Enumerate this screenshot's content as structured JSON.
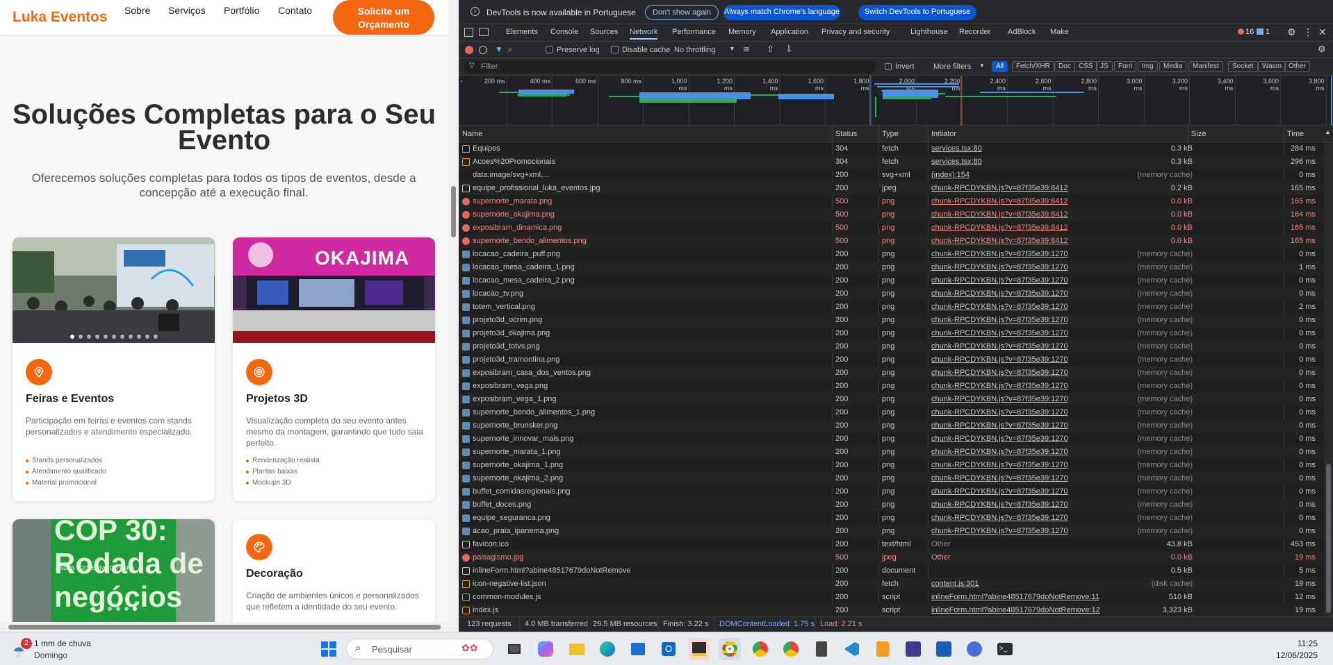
{
  "website": {
    "brand": "Luka Eventos",
    "nav": [
      "Sobre",
      "Serviços",
      "Portfólio",
      "Contato"
    ],
    "cta": "Solicite um Orçamento",
    "hero_title": "Soluções Completas para o Seu Evento",
    "hero_subtitle": "Oferecemos soluções completas para todos os tipos de eventos, desde a concepção até a execução final.",
    "cards": [
      {
        "title": "Feiras e Eventos",
        "description": "Participação em feiras e eventos com stands personalizados e atendimento especializado.",
        "features": [
          "Stands personalizados",
          "Atendimento qualificado",
          "Material promocional"
        ],
        "icon": "map-pin-icon"
      },
      {
        "title": "Projetos 3D",
        "description": "Visualização completa do seu evento antes mesmo da montagem, garantindo que tudo saia perfeito.",
        "features": [
          "Renderização realista",
          "Plantas baixas",
          "Mockups 3D"
        ],
        "icon": "target-icon",
        "image_text": "OKAJIMA"
      },
      {
        "title": "",
        "description": "",
        "features": [],
        "image_text": "COP 30: Rodada de negócios",
        "image_subtext": "BNDES - GOVERNO DO PARÁ"
      },
      {
        "title": "Decoração",
        "description": "Criação de ambientes únicos e personalizados que refletem a identidade do seu evento.",
        "features": [],
        "icon": "palette-icon"
      }
    ]
  },
  "devtools": {
    "info_bar": {
      "message": "DevTools is now available in Portuguese",
      "dont_show": "Don't show again",
      "always_match": "Always match Chrome's language",
      "switch": "Switch DevTools to Portuguese"
    },
    "tabs": [
      "Elements",
      "Console",
      "Sources",
      "Network",
      "Performance",
      "Memory",
      "Application",
      "Privacy and security",
      "Lighthouse",
      "Recorder",
      "AdBlock",
      "Make"
    ],
    "active_tab": "Network",
    "errors_count": "16",
    "messages_count": "1",
    "toolbar": {
      "preserve_log": "Preserve log",
      "disable_cache": "Disable cache",
      "throttling": "No throttling"
    },
    "filter": {
      "placeholder": "Filter",
      "invert": "Invert",
      "more_filters": "More filters",
      "types": [
        "All",
        "Fetch/XHR",
        "Doc",
        "CSS",
        "JS",
        "Font",
        "Img",
        "Media",
        "Manifest",
        "Socket",
        "Wasm",
        "Other"
      ]
    },
    "timeline_ticks": [
      "200 ms",
      "400 ms",
      "600 ms",
      "800 ms",
      "1,000 ms",
      "1,200 ms",
      "1,400 ms",
      "1,600 ms",
      "1,800 ms",
      "2,000 ms",
      "2,200 ms",
      "2,400 ms",
      "2,600 ms",
      "2,800 ms",
      "3,000 ms",
      "3,200 ms",
      "3,400 ms",
      "3,600 ms",
      "3,800 ms"
    ],
    "columns": [
      "Name",
      "Status",
      "Type",
      "Initiator",
      "Size",
      "Time"
    ],
    "rows": [
      {
        "name": "Equipes",
        "status": "304",
        "type": "fetch",
        "initiator": "services.tsx:80",
        "size": "0.3 kB",
        "time": "284 ms",
        "icon": "fetch"
      },
      {
        "name": "Acoes%20Promocionais",
        "status": "304",
        "type": "fetch",
        "initiator": "services.tsx:80",
        "size": "0.3 kB",
        "time": "296 ms",
        "icon": "fetch"
      },
      {
        "name": "data:image/svg+xml,...",
        "status": "200",
        "type": "svg+xml",
        "initiator": "(index):154",
        "size": "(memory cache)",
        "time": "0 ms",
        "icon": "none"
      },
      {
        "name": "equipe_profissional_luka_eventos.jpg",
        "status": "200",
        "type": "jpeg",
        "initiator": "chunk-RPCDYKBN.js?v=87f35e39:8412",
        "size": "0.2 kB",
        "time": "165 ms",
        "icon": "doc"
      },
      {
        "name": "supernorte_marata.png",
        "status": "500",
        "type": "png",
        "initiator": "chunk-RPCDYKBN.js?v=87f35e39:8412",
        "size": "0.0 kB",
        "time": "165 ms",
        "icon": "error"
      },
      {
        "name": "supernorte_okajima.png",
        "status": "500",
        "type": "png",
        "initiator": "chunk-RPCDYKBN.js?v=87f35e39:8412",
        "size": "0.0 kB",
        "time": "164 ms",
        "icon": "error"
      },
      {
        "name": "exposibram_dinamica.png",
        "status": "500",
        "type": "png",
        "initiator": "chunk-RPCDYKBN.js?v=87f35e39:8412",
        "size": "0.0 kB",
        "time": "165 ms",
        "icon": "error"
      },
      {
        "name": "supernorte_bendo_alimentos.png",
        "status": "500",
        "type": "png",
        "initiator": "chunk-RPCDYKBN.js?v=87f35e39:8412",
        "size": "0.0 kB",
        "time": "165 ms",
        "icon": "error"
      },
      {
        "name": "locacao_cadeira_puff.png",
        "status": "200",
        "type": "png",
        "initiator": "chunk-RPCDYKBN.js?v=87f35e39:1270",
        "size": "(memory cache)",
        "time": "0 ms",
        "icon": "img"
      },
      {
        "name": "locacao_mesa_cadeira_1.png",
        "status": "200",
        "type": "png",
        "initiator": "chunk-RPCDYKBN.js?v=87f35e39:1270",
        "size": "(memory cache)",
        "time": "1 ms",
        "icon": "img"
      },
      {
        "name": "locacao_mesa_cadeira_2.png",
        "status": "200",
        "type": "png",
        "initiator": "chunk-RPCDYKBN.js?v=87f35e39:1270",
        "size": "(memory cache)",
        "time": "0 ms",
        "icon": "img"
      },
      {
        "name": "locacao_tv.png",
        "status": "200",
        "type": "png",
        "initiator": "chunk-RPCDYKBN.js?v=87f35e39:1270",
        "size": "(memory cache)",
        "time": "0 ms",
        "icon": "img"
      },
      {
        "name": "totem_vertical.png",
        "status": "200",
        "type": "png",
        "initiator": "chunk-RPCDYKBN.js?v=87f35e39:1270",
        "size": "(memory cache)",
        "time": "2 ms",
        "icon": "img"
      },
      {
        "name": "projeto3d_ocrim.png",
        "status": "200",
        "type": "png",
        "initiator": "chunk-RPCDYKBN.js?v=87f35e39:1270",
        "size": "(memory cache)",
        "time": "0 ms",
        "icon": "img"
      },
      {
        "name": "projeto3d_okajima.png",
        "status": "200",
        "type": "png",
        "initiator": "chunk-RPCDYKBN.js?v=87f35e39:1270",
        "size": "(memory cache)",
        "time": "0 ms",
        "icon": "img"
      },
      {
        "name": "projeto3d_totvs.png",
        "status": "200",
        "type": "png",
        "initiator": "chunk-RPCDYKBN.js?v=87f35e39:1270",
        "size": "(memory cache)",
        "time": "0 ms",
        "icon": "img"
      },
      {
        "name": "projeto3d_tramontina.png",
        "status": "200",
        "type": "png",
        "initiator": "chunk-RPCDYKBN.js?v=87f35e39:1270",
        "size": "(memory cache)",
        "time": "0 ms",
        "icon": "img"
      },
      {
        "name": "exposibram_casa_dos_ventos.png",
        "status": "200",
        "type": "png",
        "initiator": "chunk-RPCDYKBN.js?v=87f35e39:1270",
        "size": "(memory cache)",
        "time": "0 ms",
        "icon": "img"
      },
      {
        "name": "exposibram_vega.png",
        "status": "200",
        "type": "png",
        "initiator": "chunk-RPCDYKBN.js?v=87f35e39:1270",
        "size": "(memory cache)",
        "time": "0 ms",
        "icon": "img"
      },
      {
        "name": "exposibram_vega_1.png",
        "status": "200",
        "type": "png",
        "initiator": "chunk-RPCDYKBN.js?v=87f35e39:1270",
        "size": "(memory cache)",
        "time": "0 ms",
        "icon": "img"
      },
      {
        "name": "supernorte_bendo_alimentos_1.png",
        "status": "200",
        "type": "png",
        "initiator": "chunk-RPCDYKBN.js?v=87f35e39:1270",
        "size": "(memory cache)",
        "time": "0 ms",
        "icon": "img"
      },
      {
        "name": "supernorte_brunsker.png",
        "status": "200",
        "type": "png",
        "initiator": "chunk-RPCDYKBN.js?v=87f35e39:1270",
        "size": "(memory cache)",
        "time": "0 ms",
        "icon": "img"
      },
      {
        "name": "supernorte_innovar_mais.png",
        "status": "200",
        "type": "png",
        "initiator": "chunk-RPCDYKBN.js?v=87f35e39:1270",
        "size": "(memory cache)",
        "time": "0 ms",
        "icon": "img"
      },
      {
        "name": "supernorte_marata_1.png",
        "status": "200",
        "type": "png",
        "initiator": "chunk-RPCDYKBN.js?v=87f35e39:1270",
        "size": "(memory cache)",
        "time": "0 ms",
        "icon": "img"
      },
      {
        "name": "supernorte_okajima_1.png",
        "status": "200",
        "type": "png",
        "initiator": "chunk-RPCDYKBN.js?v=87f35e39:1270",
        "size": "(memory cache)",
        "time": "0 ms",
        "icon": "img"
      },
      {
        "name": "supernorte_okajima_2.png",
        "status": "200",
        "type": "png",
        "initiator": "chunk-RPCDYKBN.js?v=87f35e39:1270",
        "size": "(memory cache)",
        "time": "0 ms",
        "icon": "img"
      },
      {
        "name": "buffet_comidasregionais.png",
        "status": "200",
        "type": "png",
        "initiator": "chunk-RPCDYKBN.js?v=87f35e39:1270",
        "size": "(memory cache)",
        "time": "0 ms",
        "icon": "img"
      },
      {
        "name": "buffet_doces.png",
        "status": "200",
        "type": "png",
        "initiator": "chunk-RPCDYKBN.js?v=87f35e39:1270",
        "size": "(memory cache)",
        "time": "0 ms",
        "icon": "img"
      },
      {
        "name": "equipe_seguranca.png",
        "status": "200",
        "type": "png",
        "initiator": "chunk-RPCDYKBN.js?v=87f35e39:1270",
        "size": "(memory cache)",
        "time": "0 ms",
        "icon": "img"
      },
      {
        "name": "acao_praia_ipanema.png",
        "status": "200",
        "type": "png",
        "initiator": "chunk-RPCDYKBN.js?v=87f35e39:1270",
        "size": "(memory cache)",
        "time": "0 ms",
        "icon": "img"
      },
      {
        "name": "favicon.ico",
        "status": "200",
        "type": "text/html",
        "initiator": "Other",
        "size": "43.8 kB",
        "time": "453 ms",
        "icon": "doc"
      },
      {
        "name": "paisagismo.jpg",
        "status": "500",
        "type": "jpeg",
        "initiator": "Other",
        "size": "0.0 kB",
        "time": "19 ms",
        "icon": "error"
      },
      {
        "name": "inlineForm.html?abine48517679doNotRemove",
        "status": "200",
        "type": "document",
        "initiator": "",
        "size": "0.5 kB",
        "time": "5 ms",
        "icon": "doc"
      },
      {
        "name": "icon-negative-list.json",
        "status": "200",
        "type": "fetch",
        "initiator": "content.js:301",
        "size": "(disk cache)",
        "time": "19 ms",
        "icon": "fetch"
      },
      {
        "name": "common-modules.js",
        "status": "200",
        "type": "script",
        "initiator": "inlineForm.html?abine48517679doNotRemove:11",
        "size": "510 kB",
        "time": "12 ms",
        "icon": "script"
      },
      {
        "name": "index.js",
        "status": "200",
        "type": "script",
        "initiator": "inlineForm.html?abine48517679doNotRemove:12",
        "size": "3,323 kB",
        "time": "19 ms",
        "icon": "script"
      }
    ],
    "status_bar": {
      "requests": "123 requests",
      "transferred": "4.0 MB transferred",
      "resources": "29.5 MB resources",
      "finish": "Finish: 3.22 s",
      "dom_loaded": "DOMContentLoaded: 1.75 s",
      "load": "Load: 2.21 s"
    }
  },
  "taskbar": {
    "weather_badge": "2",
    "weather": "1 mm de chuva",
    "weather_day": "Domingo",
    "search_placeholder": "Pesquisar",
    "time": "11:25",
    "date": "12/06/2025"
  },
  "colors": {
    "brand_orange": "#f2670f",
    "devtools_bg": "#1f1f1f",
    "link_blue": "#a8c7fa",
    "error_red": "#f28b82"
  }
}
